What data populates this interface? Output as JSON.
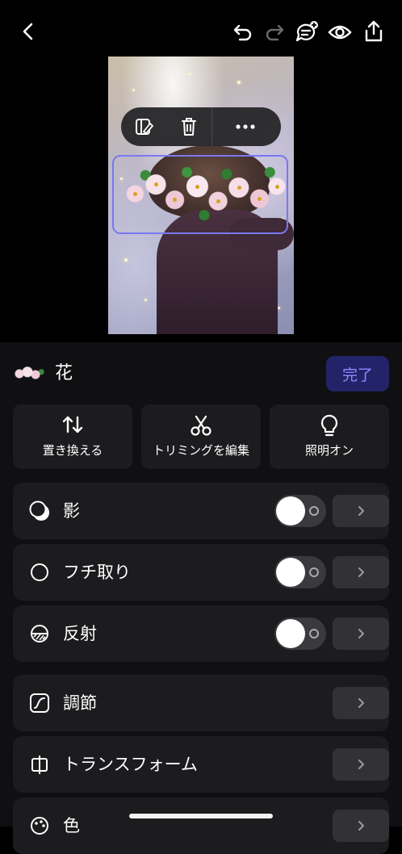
{
  "layer": {
    "title": "花",
    "done_label": "完了"
  },
  "tools": [
    {
      "label": "置き換える",
      "icon": "swap-icon"
    },
    {
      "label": "トリミングを編集",
      "icon": "scissors-icon"
    },
    {
      "label": "照明オン",
      "icon": "lightbulb-icon"
    }
  ],
  "options": [
    {
      "label": "影",
      "icon": "shadow-icon",
      "toggle": false
    },
    {
      "label": "フチ取り",
      "icon": "outline-circle-icon",
      "toggle": false
    },
    {
      "label": "反射",
      "icon": "reflection-icon",
      "toggle": false
    },
    {
      "label": "調節",
      "icon": "adjust-curve-icon"
    },
    {
      "label": "トランスフォーム",
      "icon": "transform-icon"
    },
    {
      "label": "色",
      "icon": "palette-icon"
    }
  ],
  "colors": {
    "accent": "#7a78f0",
    "done_bg": "#23236a",
    "done_text": "#8f8dff"
  }
}
